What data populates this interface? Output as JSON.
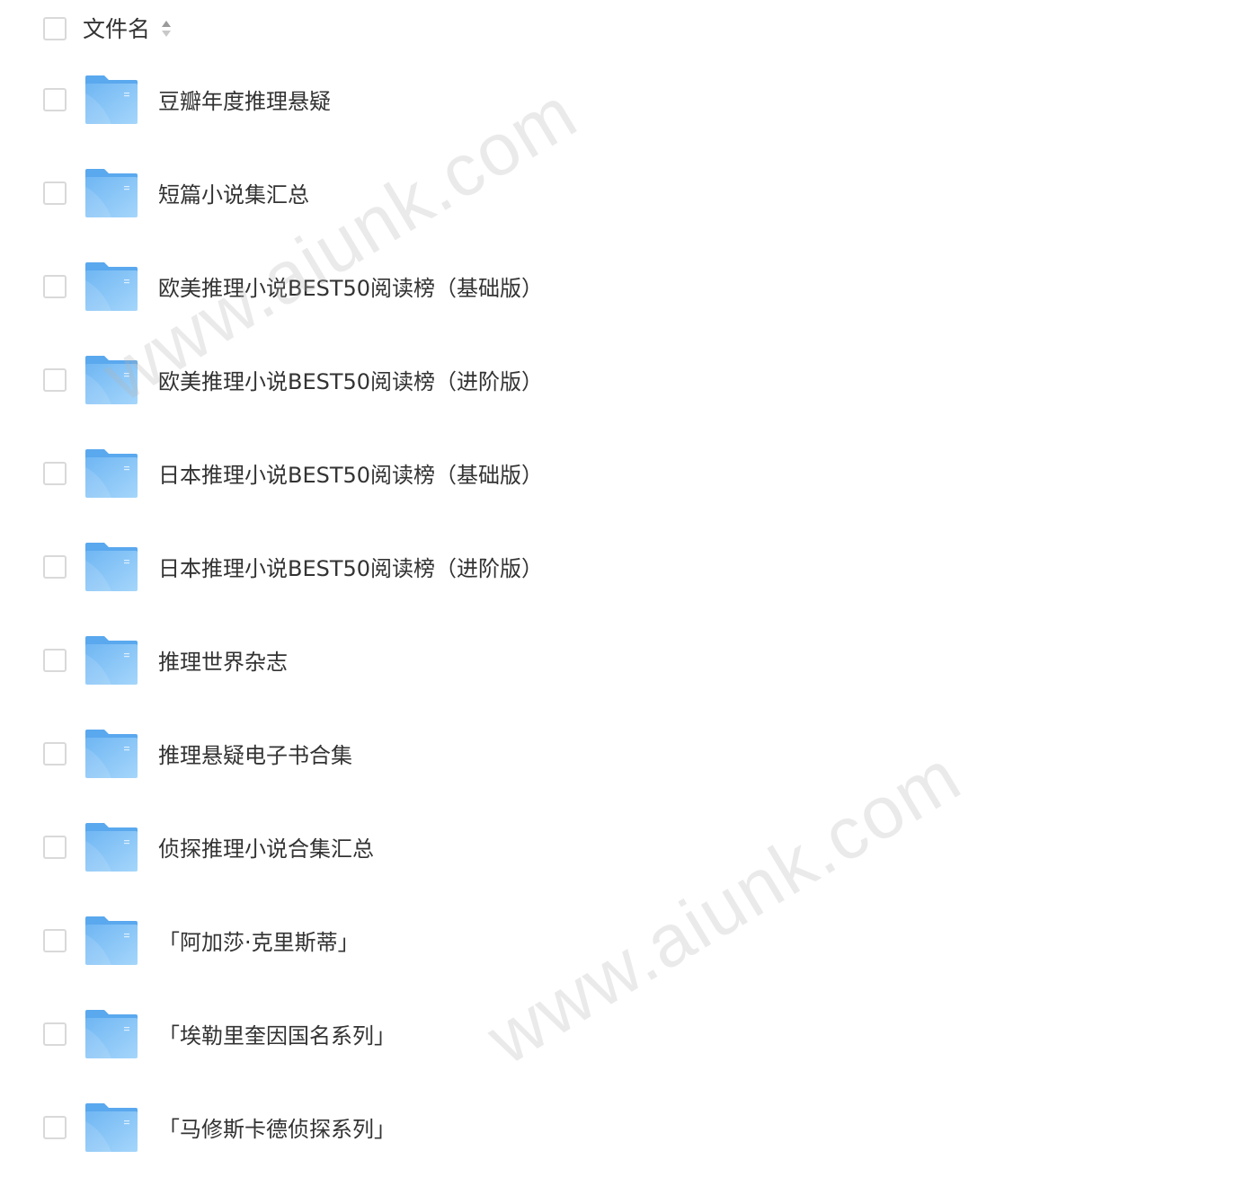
{
  "header": {
    "title": "文件名",
    "sort_icon": "sort-icon"
  },
  "files": [
    {
      "name": "豆瓣年度推理悬疑",
      "icon": "folder-icon"
    },
    {
      "name": "短篇小说集汇总",
      "icon": "folder-icon"
    },
    {
      "name": "欧美推理小说BEST50阅读榜（基础版）",
      "icon": "folder-icon"
    },
    {
      "name": "欧美推理小说BEST50阅读榜（进阶版）",
      "icon": "folder-icon"
    },
    {
      "name": "日本推理小说BEST50阅读榜（基础版）",
      "icon": "folder-icon"
    },
    {
      "name": "日本推理小说BEST50阅读榜（进阶版）",
      "icon": "folder-icon"
    },
    {
      "name": "推理世界杂志",
      "icon": "folder-icon"
    },
    {
      "name": "推理悬疑电子书合集",
      "icon": "folder-icon"
    },
    {
      "name": "侦探推理小说合集汇总",
      "icon": "folder-icon"
    },
    {
      "name": "「阿加莎·克里斯蒂」",
      "icon": "folder-icon"
    },
    {
      "name": "「埃勒里奎因国名系列」",
      "icon": "folder-icon"
    },
    {
      "name": "「马修斯卡德侦探系列」",
      "icon": "folder-icon"
    }
  ],
  "watermarks": [
    "www.aiunk.com",
    "www.aiunk.com"
  ],
  "colors": {
    "folder_light": "#8cc7f5",
    "folder_dark": "#5aaaf0",
    "checkbox_border": "#d9d9d9",
    "text": "#333333"
  }
}
